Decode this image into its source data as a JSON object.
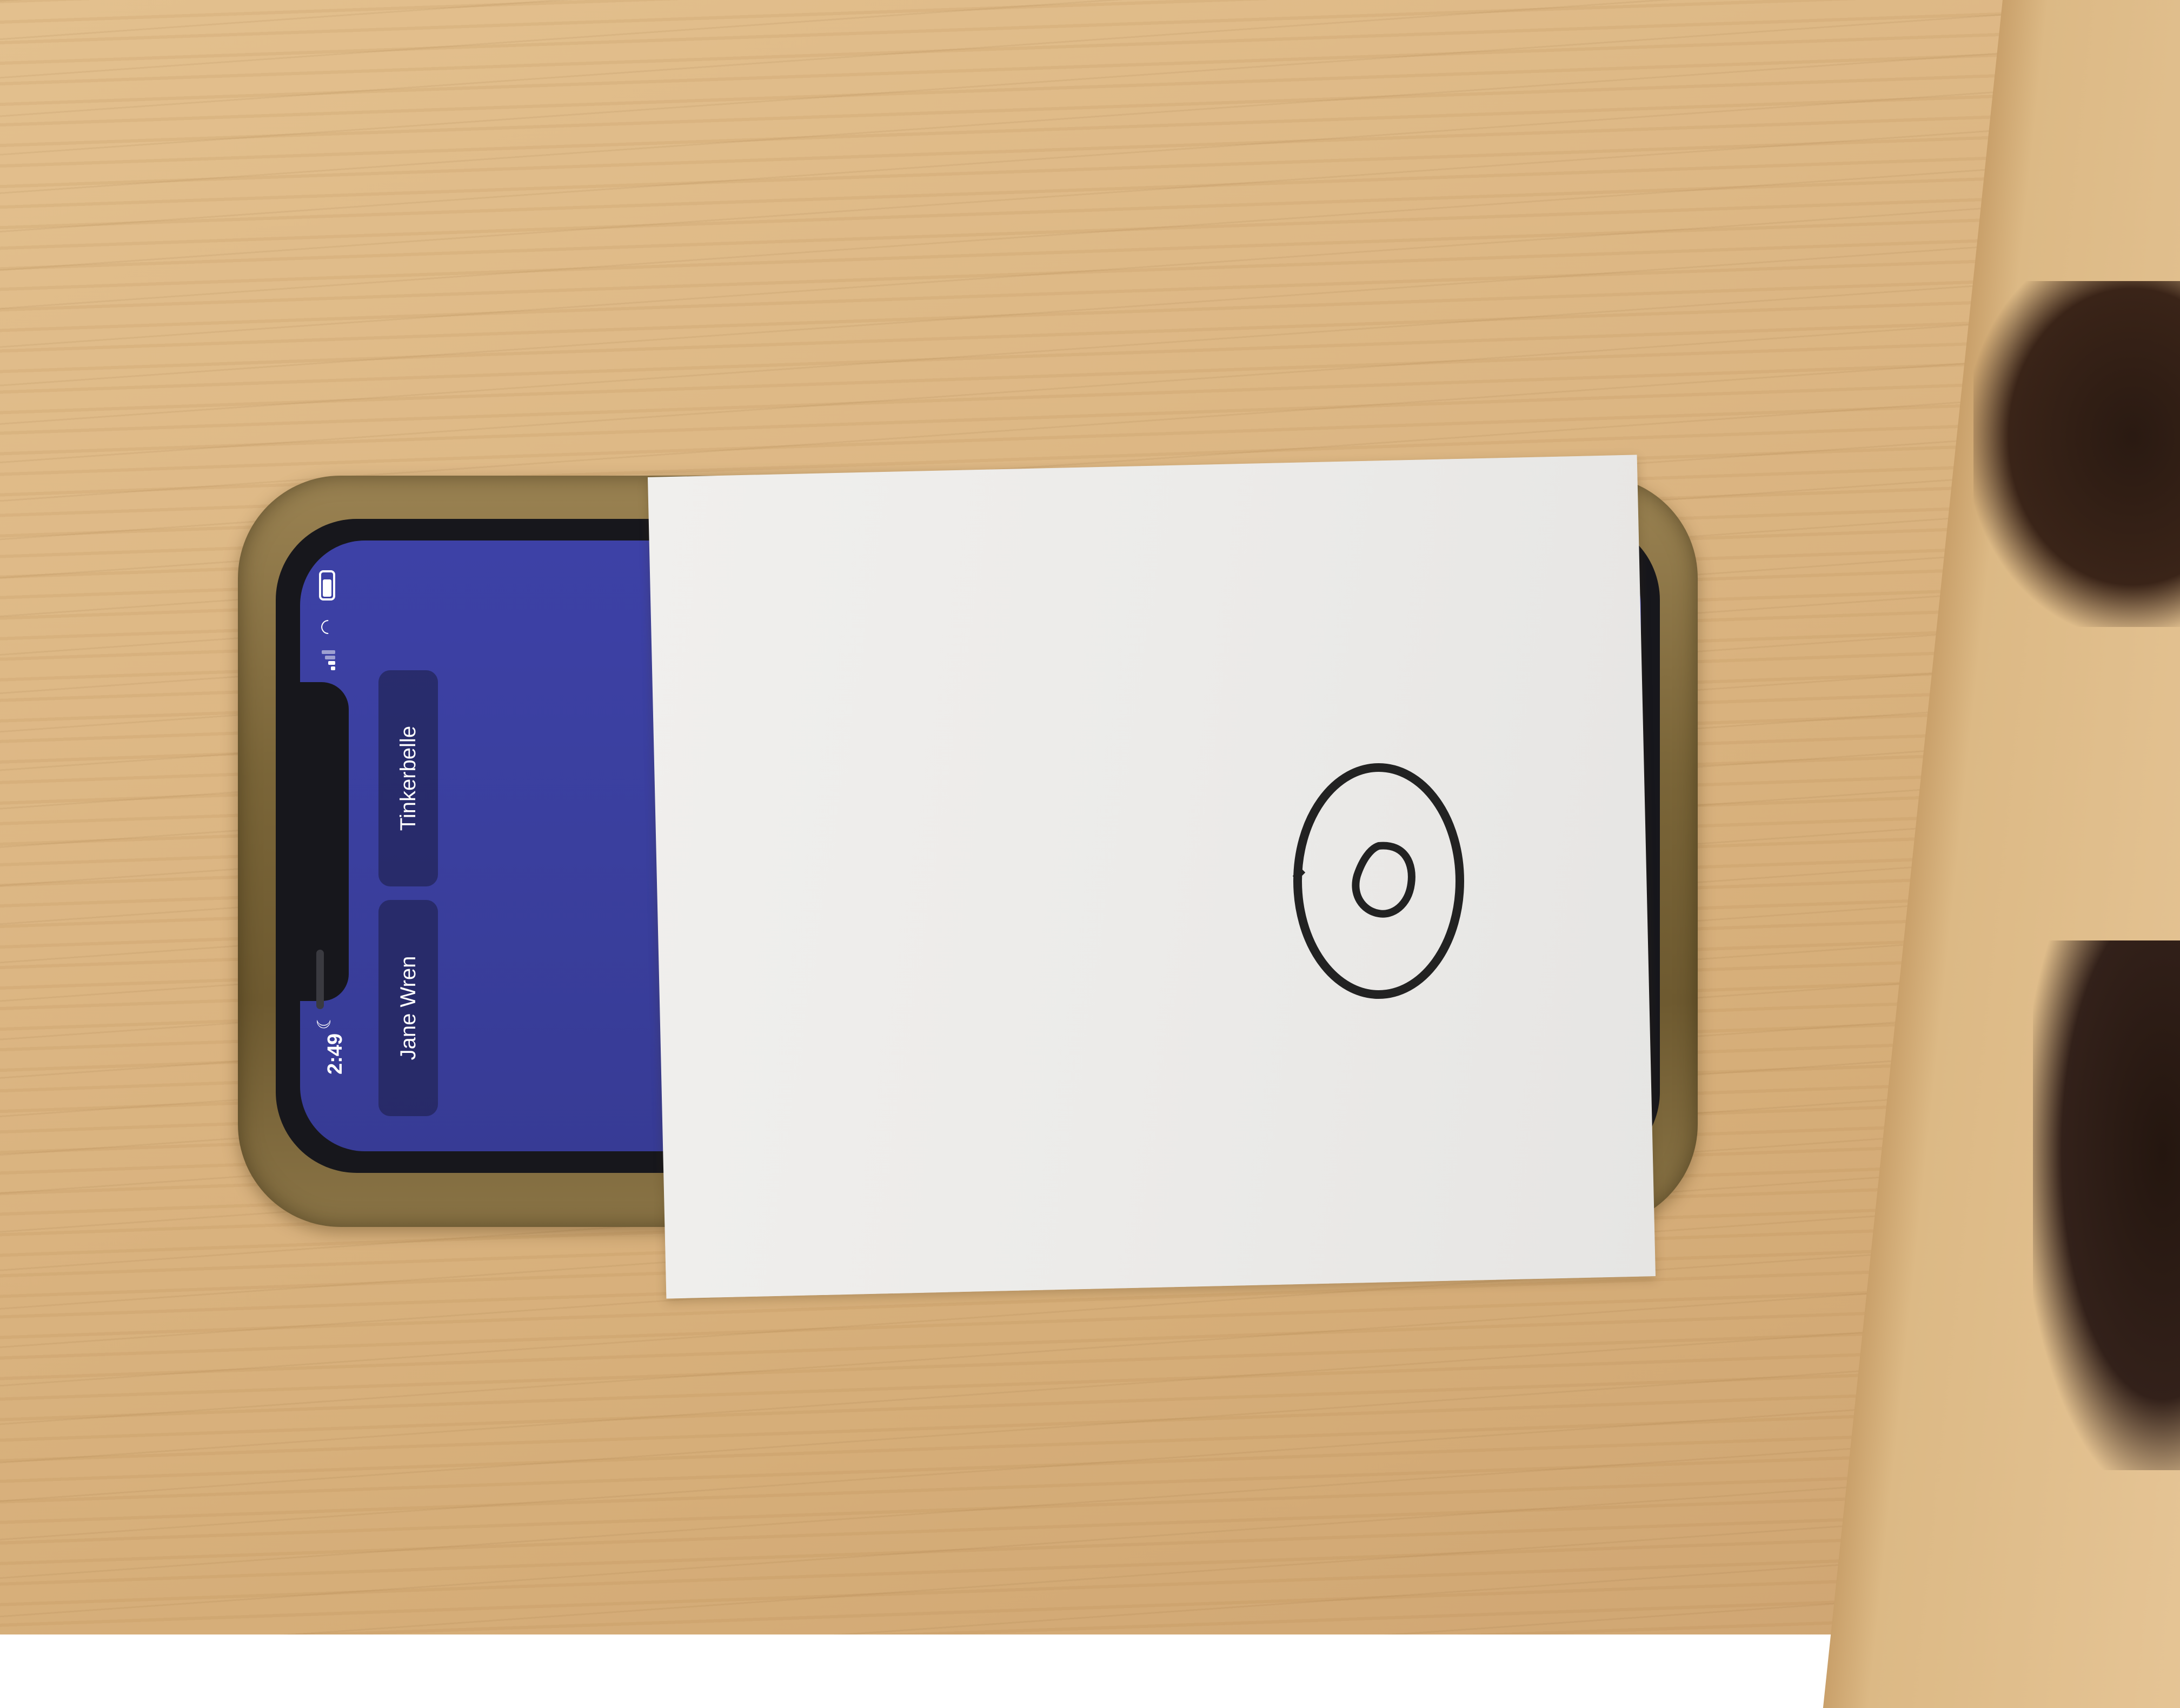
{
  "scene": {
    "table_color": "#dcb683",
    "paper_color": "#ecebe9",
    "screen_color": "#3a3f9e",
    "case_color": "#7a6538"
  },
  "status_bar": {
    "time": "2:49",
    "moon_icon": "moon-icon",
    "signal_icon": "cellular-signal-icon",
    "wifi_icon": "wifi-icon",
    "battery_icon": "battery-icon"
  },
  "contacts": [
    {
      "name": "Jane Wren"
    },
    {
      "name": "Tinkerbelle"
    }
  ],
  "paper_drawing": {
    "icon": "eye-drawing-icon"
  }
}
